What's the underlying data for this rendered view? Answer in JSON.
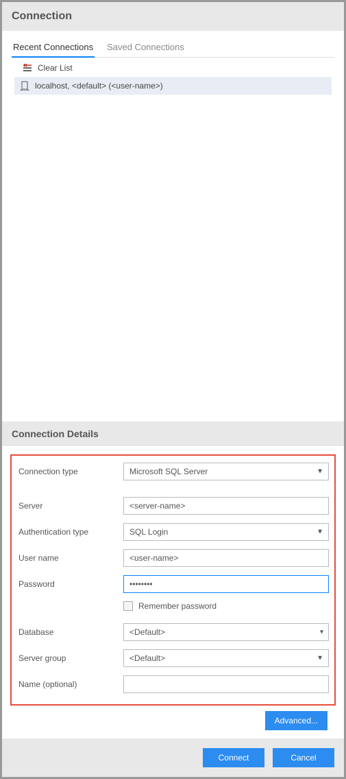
{
  "header": {
    "title": "Connection"
  },
  "tabs": {
    "recent": "Recent Connections",
    "saved": "Saved Connections"
  },
  "clear_list_label": "Clear List",
  "recent_connections": [
    {
      "text": "localhost, <default> (<user-name>)"
    }
  ],
  "details": {
    "section_title": "Connection Details",
    "connection_type_label": "Connection type",
    "connection_type_value": "Microsoft SQL Server",
    "server_label": "Server",
    "server_value": "<server-name>",
    "auth_type_label": "Authentication type",
    "auth_type_value": "SQL Login",
    "user_label": "User name",
    "user_value": "<user-name>",
    "password_label": "Password",
    "password_value": "••••••••",
    "remember_label": "Remember password",
    "database_label": "Database",
    "database_value": "<Default>",
    "server_group_label": "Server group",
    "server_group_value": "<Default>",
    "name_label": "Name (optional)",
    "name_value": ""
  },
  "buttons": {
    "advanced": "Advanced...",
    "connect": "Connect",
    "cancel": "Cancel"
  }
}
